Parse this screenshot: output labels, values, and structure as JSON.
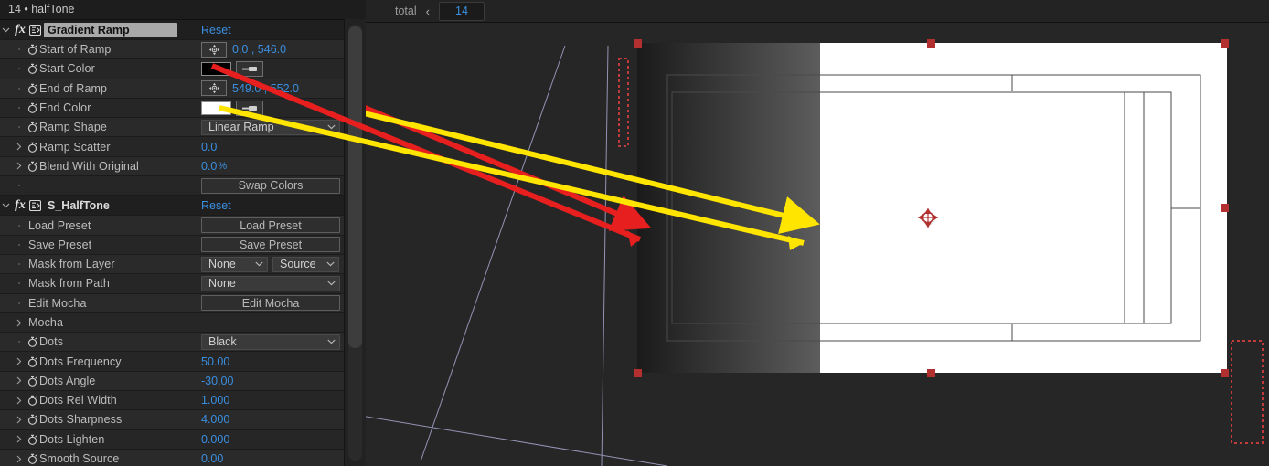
{
  "panel": {
    "title": "14 • halfTone",
    "reset_label": "Reset"
  },
  "effects": [
    {
      "name": "Gradient Ramp",
      "selected": true,
      "reset": "Reset",
      "params": [
        {
          "label": "Start of Ramp",
          "type": "point",
          "value": "0.0 , 546.0"
        },
        {
          "label": "Start Color",
          "type": "color",
          "swatch": "#000000"
        },
        {
          "label": "End of Ramp",
          "type": "point",
          "value": "549.0 , 552.0"
        },
        {
          "label": "End Color",
          "type": "color",
          "swatch": "#ffffff"
        },
        {
          "label": "Ramp Shape",
          "type": "dropdown",
          "value": "Linear Ramp"
        },
        {
          "label": "Ramp Scatter",
          "type": "number",
          "value": "0.0"
        },
        {
          "label": "Blend With Original",
          "type": "number",
          "value": "0.0",
          "unit": "%"
        },
        {
          "label": "",
          "type": "button",
          "value": "Swap Colors"
        }
      ]
    },
    {
      "name": "S_HalfTone",
      "selected": false,
      "reset": "Reset",
      "params": [
        {
          "label": "Load Preset",
          "type": "button",
          "value": "Load Preset"
        },
        {
          "label": "Save Preset",
          "type": "button",
          "value": "Save Preset"
        },
        {
          "label": "Mask from Layer",
          "type": "dropdown2",
          "value": "None",
          "value2": "Source"
        },
        {
          "label": "Mask from Path",
          "type": "dropdown",
          "value": "None"
        },
        {
          "label": "Edit Mocha",
          "type": "button",
          "value": "Edit Mocha"
        },
        {
          "label": "Mocha",
          "type": "group"
        },
        {
          "label": "Dots",
          "type": "dropdown",
          "value": "Black"
        },
        {
          "label": "Dots Frequency",
          "type": "number",
          "value": "50.00"
        },
        {
          "label": "Dots Angle",
          "type": "number",
          "value": "-30.00"
        },
        {
          "label": "Dots Rel Width",
          "type": "number",
          "value": "1.000"
        },
        {
          "label": "Dots Sharpness",
          "type": "number",
          "value": "4.000"
        },
        {
          "label": "Dots Lighten",
          "type": "number",
          "value": "0.000"
        },
        {
          "label": "Smooth Source",
          "type": "number",
          "value": "0.00"
        }
      ]
    }
  ],
  "viewer": {
    "total_label": "total",
    "prev_icon": "chevron-left-icon",
    "frame_value": "14"
  },
  "colors": {
    "accent_blue": "#3a8fe0",
    "handle_red": "#b33030",
    "annotation_red": "#e81f1f",
    "annotation_yellow": "#ffe500",
    "mask_path": "#a7a7cf",
    "panel_bg": "#232323",
    "row_bg": "#2a2a2a"
  }
}
